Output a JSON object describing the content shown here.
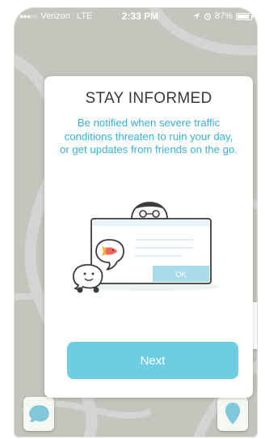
{
  "status_bar": {
    "carrier": "Verizon",
    "network": "LTE",
    "time": "2:33 PM",
    "battery": "87%",
    "battery_level": 0.87
  },
  "dialog": {
    "title": "STAY INFORMED",
    "body": "Be notified when severe traffic conditions threaten to ruin your day, or get updates from friends on the go.",
    "illustration_ok_label": "OK",
    "next_label": "Next"
  },
  "icons": {
    "wazer_button": "waze-icon",
    "location_button": "map-pin-icon"
  },
  "colors": {
    "accent": "#6fcde2",
    "body_text": "#35b3d6",
    "title_text": "#3a3a3a"
  }
}
